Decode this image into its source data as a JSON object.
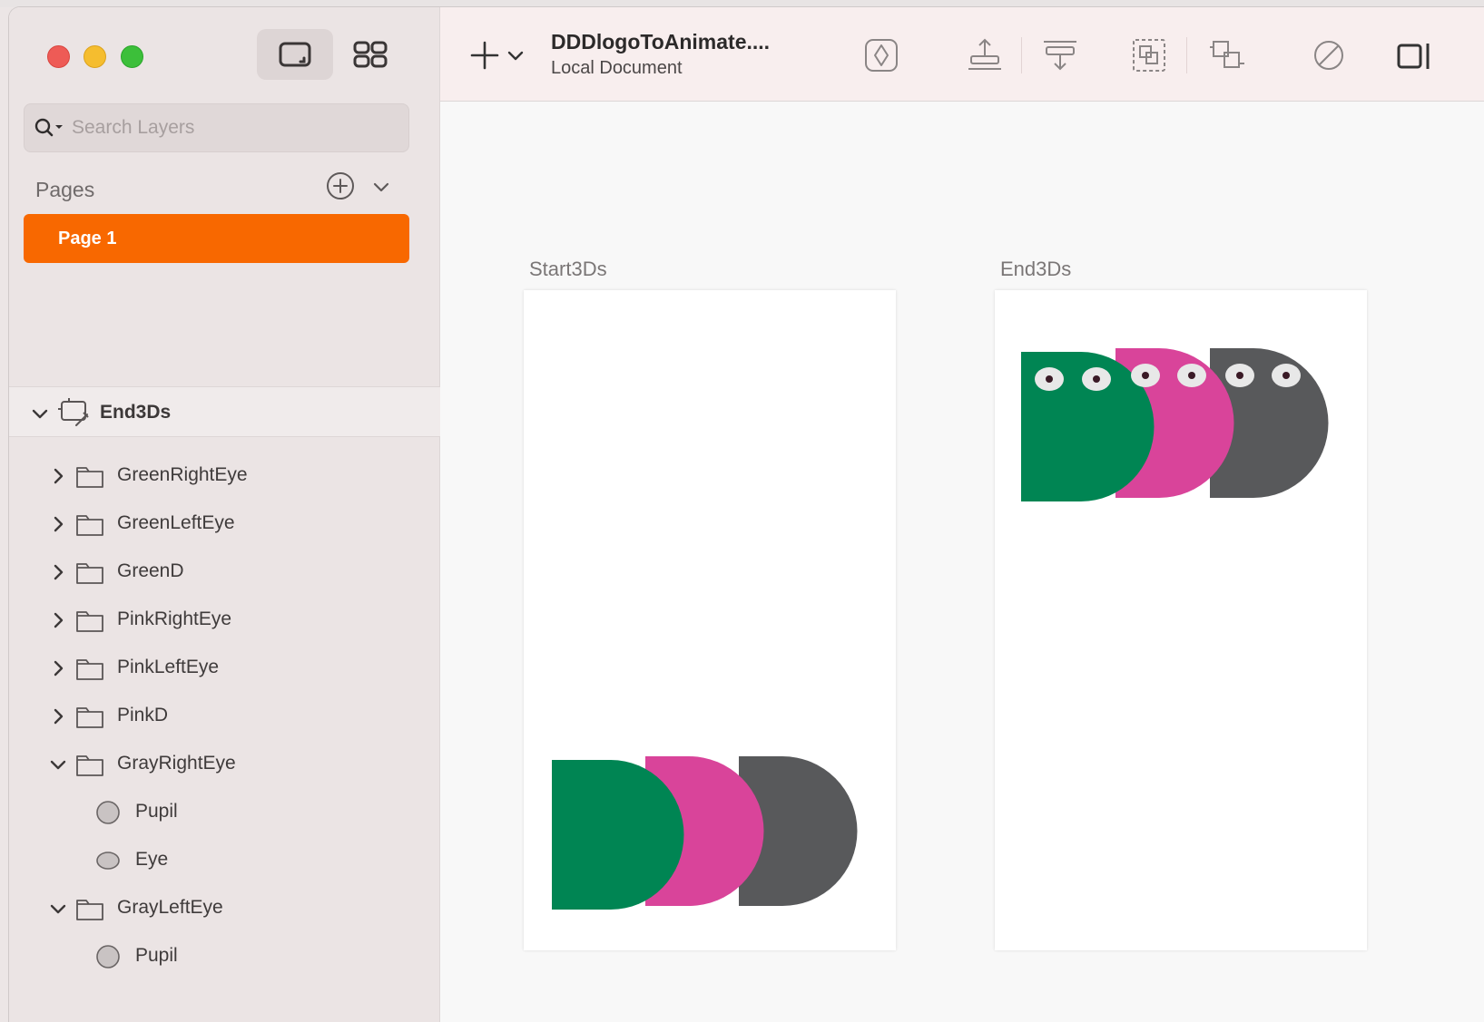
{
  "window": {
    "traffic_lights": [
      "close",
      "minimize",
      "zoom"
    ],
    "view_buttons": [
      "canvas-view-icon",
      "grid-view-icon"
    ]
  },
  "sidebar": {
    "search": {
      "placeholder": "Search Layers",
      "value": ""
    },
    "pages_label": "Pages",
    "pages": [
      {
        "label": "Page 1",
        "selected": true
      }
    ],
    "layers_header": "End3Ds",
    "layers": [
      {
        "label": "GreenRightEye",
        "type": "group",
        "expanded": false,
        "depth": 0
      },
      {
        "label": "GreenLeftEye",
        "type": "group",
        "expanded": false,
        "depth": 0
      },
      {
        "label": "GreenD",
        "type": "group",
        "expanded": false,
        "depth": 0
      },
      {
        "label": "PinkRightEye",
        "type": "group",
        "expanded": false,
        "depth": 0
      },
      {
        "label": "PinkLeftEye",
        "type": "group",
        "expanded": false,
        "depth": 0
      },
      {
        "label": "PinkD",
        "type": "group",
        "expanded": false,
        "depth": 0
      },
      {
        "label": "GrayRightEye",
        "type": "group",
        "expanded": true,
        "depth": 0
      },
      {
        "label": "Pupil",
        "type": "circle",
        "depth": 1
      },
      {
        "label": "Eye",
        "type": "ellipse",
        "depth": 1
      },
      {
        "label": "GrayLeftEye",
        "type": "group",
        "expanded": true,
        "depth": 0
      },
      {
        "label": "Pupil",
        "type": "circle",
        "depth": 1
      }
    ]
  },
  "toolbar": {
    "document_title": "DDDlogoToAnimate....",
    "document_subtitle": "Local Document",
    "icons": [
      "insert-plus-icon",
      "insert-chevron-icon",
      "create-symbol-icon",
      "align-bottom-icon",
      "distribute-icon",
      "group-icon",
      "ungroup-icon",
      "mask-icon",
      "frame-icon"
    ]
  },
  "canvas": {
    "artboards": [
      {
        "name": "Start3Ds"
      },
      {
        "name": "End3Ds"
      }
    ]
  },
  "colors": {
    "accent_orange": "#f86800",
    "green": "#008553",
    "pink": "#d9449a",
    "gray": "#58595b",
    "eye_white": "#e8e8e8",
    "pupil": "#3a1a26"
  }
}
